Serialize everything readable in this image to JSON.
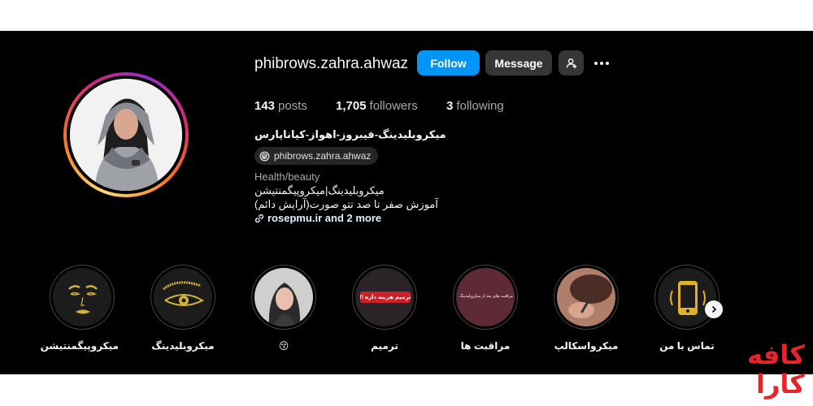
{
  "profile": {
    "username": "phibrows.zahra.ahwaz",
    "follow_label": "Follow",
    "message_label": "Message",
    "stats": {
      "posts_count": "143",
      "posts_label": "posts",
      "followers_count": "1,705",
      "followers_label": "followers",
      "following_count": "3",
      "following_label": "following"
    },
    "full_name": "میکروبلیدینگ-فیبروز-اهواز-کیاناپارس",
    "threads_handle": "phibrows.zahra.ahwaz",
    "category": "Health/beauty",
    "bio_lines": [
      "میکروبلیدینگ|میکروپیگمنتیشن",
      "آموزش صفر تا صد تتو صورت(آرایش دائم)"
    ],
    "link_text": "rosepmu.ir and 2 more"
  },
  "highlights": [
    {
      "label": "میکروپیگمنتیشن",
      "icon": "lips-icon"
    },
    {
      "label": "میکروبلیدینگ",
      "icon": "eye-brow-icon"
    },
    {
      "label": "😚",
      "icon": "portrait-photo"
    },
    {
      "label": "ترمیم",
      "icon": "retouch-cover",
      "cover_text": "ترمیم هزینه داره !!"
    },
    {
      "label": "مراقبت ها",
      "icon": "care-cover",
      "cover_text": "مراقبت های بعد از میکروبلیدینگ"
    },
    {
      "label": "میکرواسکالپ",
      "icon": "scalp-photo"
    },
    {
      "label": "تماس با من",
      "icon": "phone-icon"
    }
  ],
  "colors": {
    "background": "#000000",
    "follow_button": "#0095f6",
    "secondary_button": "#363636",
    "watermark": "#e8242b"
  },
  "watermark": {
    "line1": "کافه",
    "line2": "کارا"
  }
}
